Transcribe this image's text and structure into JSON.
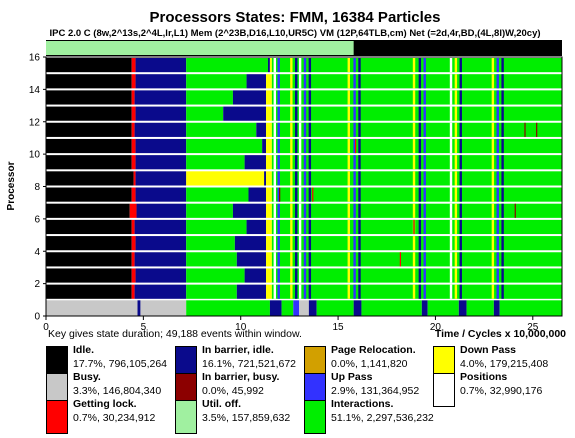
{
  "chart_data": {
    "type": "bar",
    "title": "Processors States: FMM, 16384 Particles",
    "subtitle": "IPC 2.0  C (8w,2^13s,2^4L,lr,L1)  Mem  (2^23B,D16,L10,UR5C)  VM (12P,64TLB,cm)  Net (=2d,4r,BD,(4L,8l)W,20cy)",
    "xlabel": "Time / Cycles x 10,000,000",
    "ylabel": "Processor",
    "xlim": [
      0,
      26.5
    ],
    "ylim": [
      0,
      16
    ],
    "xticks": [
      "0",
      "5",
      "10",
      "15",
      "20",
      "25"
    ],
    "yticks": [
      "0",
      "2",
      "4",
      "6",
      "8",
      "10",
      "12",
      "14",
      "16"
    ],
    "util_bar": {
      "state": "Util. off.",
      "until": 15.8
    },
    "legend_note": "Key gives state duration; 49,188 events within window.",
    "states": [
      {
        "key": "idle",
        "name": "Idle.",
        "pct": "17.7%",
        "count": "796,105,264",
        "color": "#000000"
      },
      {
        "key": "busy",
        "name": "Busy.",
        "pct": "3.3%",
        "count": "146,804,340",
        "color": "#c8c8c8"
      },
      {
        "key": "lock",
        "name": "Getting lock.",
        "pct": "0.7%",
        "count": "30,234,912",
        "color": "#ff0000"
      },
      {
        "key": "barIdle",
        "name": "In barrier, idle.",
        "pct": "16.1%",
        "count": "721,521,672",
        "color": "#0a0a8c"
      },
      {
        "key": "barBusy",
        "name": "In barrier, busy.",
        "pct": "0.0%",
        "count": "45,992",
        "color": "#8c0000"
      },
      {
        "key": "util",
        "name": "Util. off.",
        "pct": "3.5%",
        "count": "157,859,632",
        "color": "#a0f0a0"
      },
      {
        "key": "reloc",
        "name": "Page Relocation.",
        "pct": "0.0%",
        "count": "1,141,820",
        "color": "#d2a000"
      },
      {
        "key": "up",
        "name": "Up Pass",
        "pct": "2.9%",
        "count": "131,364,952",
        "color": "#3232ff"
      },
      {
        "key": "inter",
        "name": "Interactions.",
        "pct": "51.1%",
        "count": "2,297,536,232",
        "color": "#00ee00"
      },
      {
        "key": "down",
        "name": "Down Pass",
        "pct": "4.0%",
        "count": "179,215,408",
        "color": "#ffff00"
      },
      {
        "key": "pos",
        "name": "Positions",
        "pct": "0.7%",
        "count": "32,990,176",
        "color": "#ffffff"
      }
    ],
    "processors": [
      [
        [
          "busy",
          0,
          4.7
        ],
        [
          "barIdle",
          4.7,
          4.85
        ],
        [
          "busy",
          4.85,
          7.2
        ],
        [
          "inter",
          7.2,
          11.5
        ],
        [
          "barIdle",
          11.5,
          12.1
        ],
        [
          "inter",
          12.1,
          12.7
        ],
        [
          "up",
          12.7,
          13.0
        ],
        [
          "busy",
          13.0,
          13.5
        ],
        [
          "barIdle",
          13.5,
          13.9
        ],
        [
          "inter",
          13.9,
          15.8
        ],
        [
          "barIdle",
          15.8,
          16.2
        ],
        [
          "inter",
          16.2,
          19.3
        ],
        [
          "barIdle",
          19.3,
          19.6
        ],
        [
          "inter",
          19.6,
          21.2
        ],
        [
          "barIdle",
          21.2,
          21.6
        ],
        [
          "inter",
          21.6,
          23.0
        ],
        [
          "barIdle",
          23.0,
          23.3
        ],
        [
          "inter",
          23.3,
          26.5
        ]
      ],
      [
        [
          "idle",
          0,
          4.4
        ],
        [
          "lock",
          4.4,
          4.55
        ],
        [
          "barIdle",
          4.55,
          7.2
        ],
        [
          "inter",
          7.2,
          9.8
        ],
        [
          "barIdle",
          9.8,
          11.3
        ],
        [
          "down",
          11.3,
          11.6
        ],
        [
          "inter",
          11.6,
          26.5
        ]
      ],
      [
        [
          "idle",
          0,
          4.4
        ],
        [
          "lock",
          4.4,
          4.6
        ],
        [
          "barIdle",
          4.6,
          7.2
        ],
        [
          "inter",
          7.2,
          10.2
        ],
        [
          "barIdle",
          10.2,
          11.3
        ],
        [
          "down",
          11.3,
          11.6
        ],
        [
          "inter",
          11.6,
          26.5
        ]
      ],
      [
        [
          "idle",
          0,
          4.4
        ],
        [
          "lock",
          4.4,
          4.55
        ],
        [
          "barIdle",
          4.55,
          7.2
        ],
        [
          "inter",
          7.2,
          9.8
        ],
        [
          "barIdle",
          9.8,
          11.3
        ],
        [
          "down",
          11.3,
          11.6
        ],
        [
          "inter",
          11.6,
          26.5
        ]
      ],
      [
        [
          "idle",
          0,
          4.4
        ],
        [
          "lock",
          4.4,
          4.6
        ],
        [
          "barIdle",
          4.6,
          7.2
        ],
        [
          "inter",
          7.2,
          9.7
        ],
        [
          "barIdle",
          9.7,
          11.3
        ],
        [
          "down",
          11.3,
          11.6
        ],
        [
          "inter",
          11.6,
          26.5
        ]
      ],
      [
        [
          "idle",
          0,
          4.4
        ],
        [
          "lock",
          4.4,
          4.55
        ],
        [
          "barIdle",
          4.55,
          7.2
        ],
        [
          "inter",
          7.2,
          10.3
        ],
        [
          "barIdle",
          10.3,
          11.3
        ],
        [
          "down",
          11.3,
          11.6
        ],
        [
          "inter",
          11.6,
          26.5
        ]
      ],
      [
        [
          "idle",
          0,
          4.3
        ],
        [
          "lock",
          4.3,
          4.65
        ],
        [
          "barIdle",
          4.65,
          7.2
        ],
        [
          "inter",
          7.2,
          9.6
        ],
        [
          "barIdle",
          9.6,
          11.3
        ],
        [
          "down",
          11.3,
          11.6
        ],
        [
          "inter",
          11.6,
          26.5
        ]
      ],
      [
        [
          "idle",
          0,
          4.4
        ],
        [
          "lock",
          4.4,
          4.6
        ],
        [
          "barIdle",
          4.6,
          7.2
        ],
        [
          "inter",
          7.2,
          10.4
        ],
        [
          "barIdle",
          10.4,
          11.3
        ],
        [
          "down",
          11.3,
          11.6
        ],
        [
          "inter",
          11.6,
          26.5
        ]
      ],
      [
        [
          "idle",
          0,
          4.5
        ],
        [
          "lock",
          4.5,
          4.6
        ],
        [
          "barIdle",
          4.6,
          7.2
        ],
        [
          "down",
          7.2,
          11.2
        ],
        [
          "barIdle",
          11.2,
          11.3
        ],
        [
          "down",
          11.3,
          11.6
        ],
        [
          "inter",
          11.6,
          26.5
        ]
      ],
      [
        [
          "idle",
          0,
          4.4
        ],
        [
          "lock",
          4.4,
          4.6
        ],
        [
          "barIdle",
          4.6,
          7.2
        ],
        [
          "inter",
          7.2,
          10.2
        ],
        [
          "barIdle",
          10.2,
          11.3
        ],
        [
          "down",
          11.3,
          11.6
        ],
        [
          "inter",
          11.6,
          26.5
        ]
      ],
      [
        [
          "idle",
          0,
          4.4
        ],
        [
          "lock",
          4.4,
          4.6
        ],
        [
          "barIdle",
          4.6,
          7.2
        ],
        [
          "inter",
          7.2,
          11.1
        ],
        [
          "barIdle",
          11.1,
          11.3
        ],
        [
          "down",
          11.3,
          11.6
        ],
        [
          "inter",
          11.6,
          26.5
        ]
      ],
      [
        [
          "idle",
          0,
          4.4
        ],
        [
          "lock",
          4.4,
          4.55
        ],
        [
          "barIdle",
          4.55,
          7.2
        ],
        [
          "inter",
          7.2,
          10.8
        ],
        [
          "barIdle",
          10.8,
          11.3
        ],
        [
          "down",
          11.3,
          11.6
        ],
        [
          "inter",
          11.6,
          26.5
        ]
      ],
      [
        [
          "idle",
          0,
          4.4
        ],
        [
          "lock",
          4.4,
          4.6
        ],
        [
          "barIdle",
          4.6,
          7.2
        ],
        [
          "inter",
          7.2,
          9.1
        ],
        [
          "barIdle",
          9.1,
          11.3
        ],
        [
          "down",
          11.3,
          11.6
        ],
        [
          "inter",
          11.6,
          26.5
        ]
      ],
      [
        [
          "idle",
          0,
          4.4
        ],
        [
          "lock",
          4.4,
          4.55
        ],
        [
          "barIdle",
          4.55,
          7.2
        ],
        [
          "inter",
          7.2,
          9.6
        ],
        [
          "barIdle",
          9.6,
          11.3
        ],
        [
          "down",
          11.3,
          11.6
        ],
        [
          "inter",
          11.6,
          26.5
        ]
      ],
      [
        [
          "idle",
          0,
          4.4
        ],
        [
          "lock",
          4.4,
          4.6
        ],
        [
          "barIdle",
          4.6,
          7.2
        ],
        [
          "inter",
          7.2,
          10.3
        ],
        [
          "barIdle",
          10.3,
          11.3
        ],
        [
          "down",
          11.3,
          11.6
        ],
        [
          "inter",
          11.6,
          26.5
        ]
      ],
      [
        [
          "idle",
          0,
          4.4
        ],
        [
          "lock",
          4.4,
          4.6
        ],
        [
          "barIdle",
          4.6,
          7.2
        ],
        [
          "inter",
          7.2,
          11.4
        ],
        [
          "barIdle",
          11.4,
          11.5
        ],
        [
          "down",
          11.5,
          11.6
        ],
        [
          "inter",
          11.6,
          26.5
        ]
      ]
    ],
    "common_markers": [
      {
        "state": "pos",
        "at": 11.75
      },
      {
        "state": "up",
        "at": 11.95
      },
      {
        "state": "down",
        "at": 12.6
      },
      {
        "state": "barIdle",
        "at": 12.85
      },
      {
        "state": "pos",
        "at": 13.05
      },
      {
        "state": "up",
        "at": 13.3
      },
      {
        "state": "barIdle",
        "at": 13.55
      },
      {
        "state": "down",
        "at": 15.55
      },
      {
        "state": "up",
        "at": 15.85
      },
      {
        "state": "barIdle",
        "at": 16.1
      },
      {
        "state": "down",
        "at": 18.9
      },
      {
        "state": "barIdle",
        "at": 19.2
      },
      {
        "state": "up",
        "at": 19.45
      },
      {
        "state": "pos",
        "at": 20.8
      },
      {
        "state": "down",
        "at": 21.05
      },
      {
        "state": "barIdle",
        "at": 21.3
      },
      {
        "state": "down",
        "at": 22.95
      },
      {
        "state": "up",
        "at": 23.2
      },
      {
        "state": "barIdle",
        "at": 23.45
      }
    ],
    "extra_marks": [
      {
        "proc": 11,
        "state": "barBusy",
        "at": 24.6
      },
      {
        "proc": 11,
        "state": "barBusy",
        "at": 25.2
      },
      {
        "proc": 10,
        "state": "lock",
        "at": 15.9
      },
      {
        "proc": 7,
        "state": "barBusy",
        "at": 12.0
      },
      {
        "proc": 7,
        "state": "lock",
        "at": 13.7
      },
      {
        "proc": 6,
        "state": "barBusy",
        "at": 24.1
      },
      {
        "proc": 5,
        "state": "barBusy",
        "at": 18.9
      },
      {
        "proc": 3,
        "state": "lock",
        "at": 18.2
      }
    ]
  }
}
